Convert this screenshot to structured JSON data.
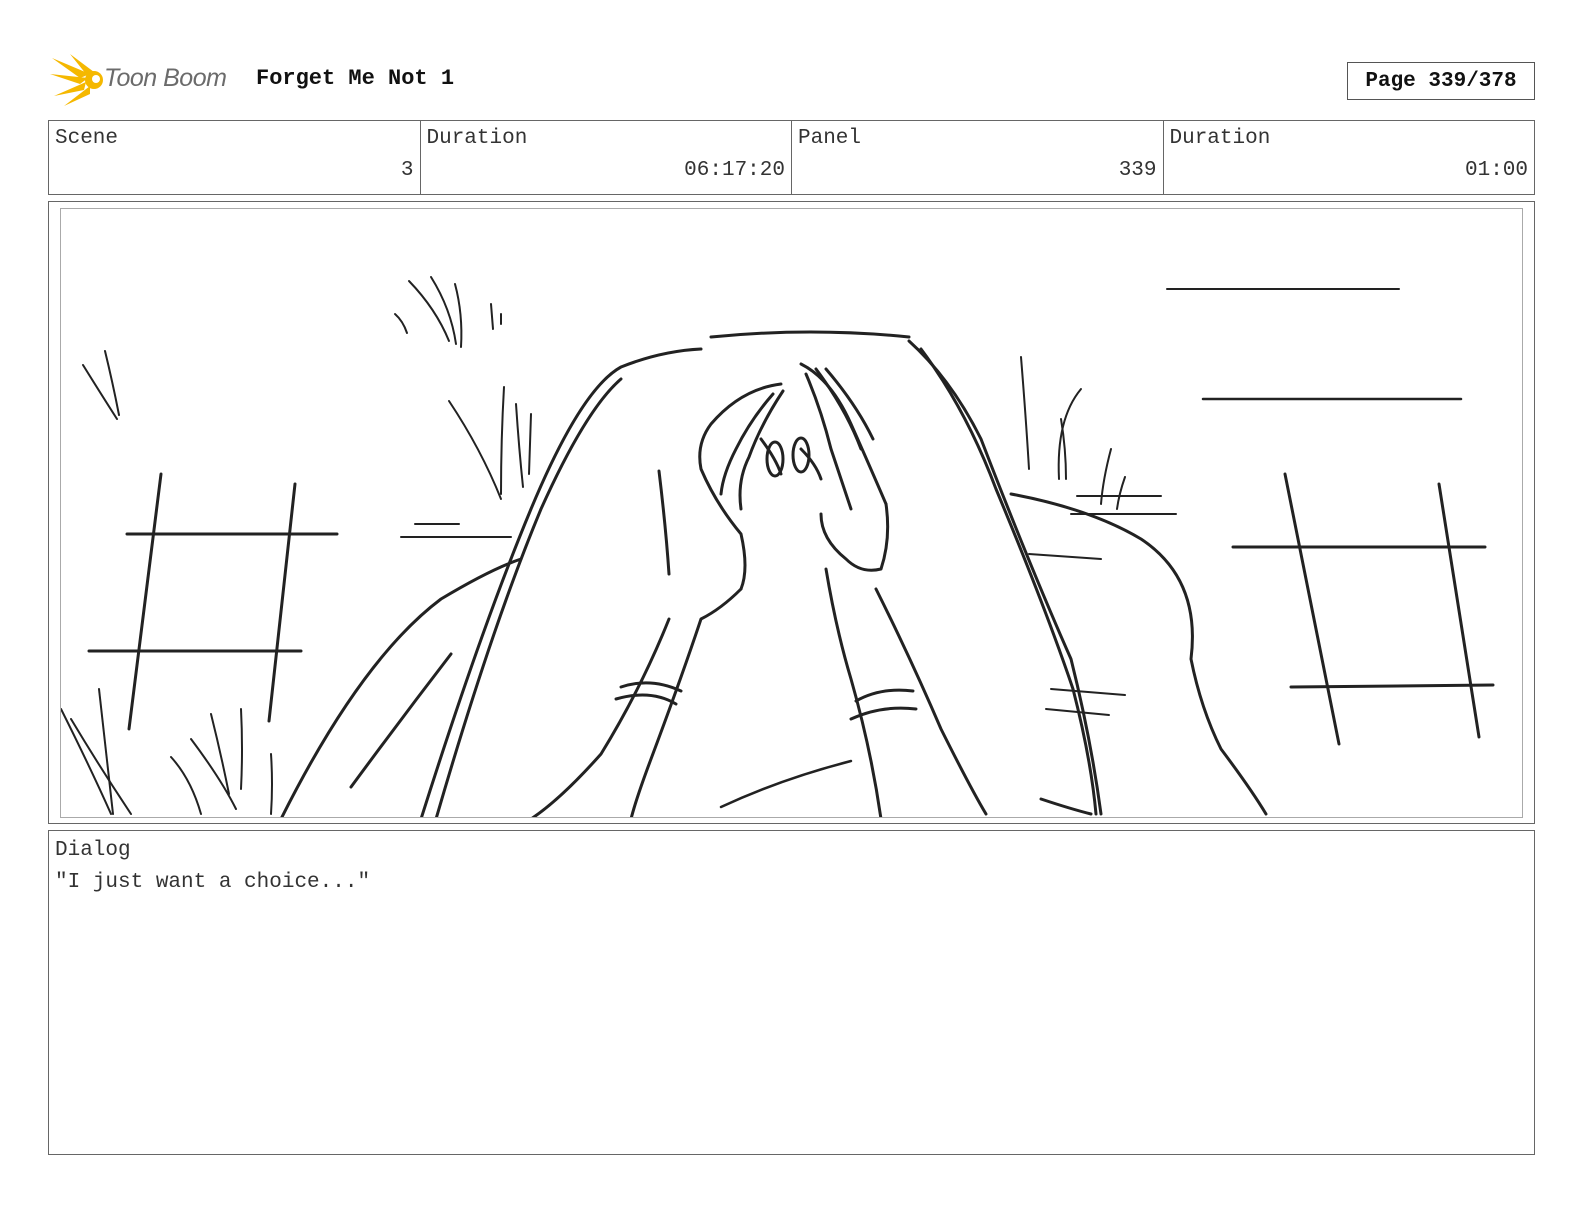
{
  "header": {
    "logo_text": "Toon Boom",
    "title": "Forget Me Not 1",
    "page": "Page 339/378"
  },
  "info": {
    "scene_label": "Scene",
    "scene_value": "3",
    "scene_duration_label": "Duration",
    "scene_duration_value": "06:17:20",
    "panel_label": "Panel",
    "panel_value": "339",
    "panel_duration_label": "Duration",
    "panel_duration_value": "01:00"
  },
  "dialog": {
    "label": "Dialog",
    "text": "\"I just want a choice...\""
  },
  "colors": {
    "logo_yellow": "#f5b800",
    "logo_text": "#6b6b6b",
    "sketch_line": "#222222"
  }
}
